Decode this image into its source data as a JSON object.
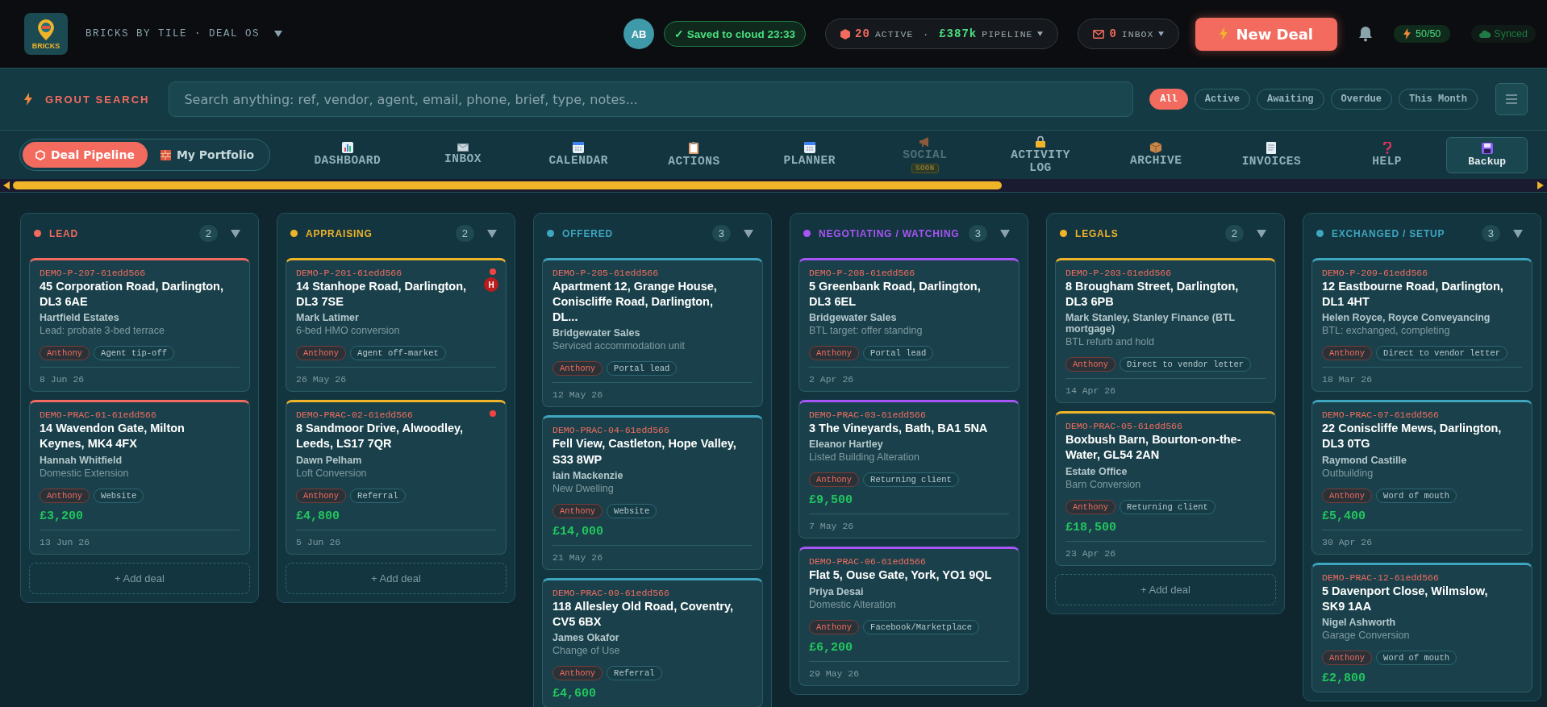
{
  "header": {
    "logo_text": "BRICKS",
    "app_title": "BRICKS BY TILE · DEAL OS",
    "avatar": "AB",
    "saved": "✓ Saved to cloud 23:33",
    "stats": {
      "active_count": "20",
      "active_label": "ACTIVE",
      "separator": "·",
      "pipeline_value": "£387k",
      "pipeline_label": "PIPELINE"
    },
    "inbox": {
      "count": "0",
      "label": "INBOX"
    },
    "new_deal": "New Deal",
    "quota": "50/50",
    "sync": "Synced"
  },
  "search": {
    "label": "GROUT SEARCH",
    "placeholder": "Search anything: ref, vendor, agent, email, phone, brief, type, notes...",
    "filters": [
      {
        "label": "All",
        "selected": true
      },
      {
        "label": "Active",
        "selected": false
      },
      {
        "label": "Awaiting",
        "selected": false
      },
      {
        "label": "Overdue",
        "selected": false
      },
      {
        "label": "This Month",
        "selected": false
      }
    ]
  },
  "modes": [
    {
      "label": "Deal Pipeline",
      "selected": true
    },
    {
      "label": "My Portfolio",
      "selected": false
    }
  ],
  "nav": [
    {
      "label": "DASHBOARD",
      "disabled": false
    },
    {
      "label": "INBOX",
      "disabled": false
    },
    {
      "label": "CALENDAR",
      "disabled": false
    },
    {
      "label": "ACTIONS",
      "disabled": false
    },
    {
      "label": "PLANNER",
      "disabled": false
    },
    {
      "label": "SOCIAL",
      "disabled": true,
      "badge": "SOON"
    },
    {
      "label": "ACTIVITY LOG",
      "disabled": false
    },
    {
      "label": "ARCHIVE",
      "disabled": false
    },
    {
      "label": "INVOICES",
      "disabled": false
    },
    {
      "label": "HELP",
      "disabled": false
    }
  ],
  "backup": {
    "label": "Backup"
  },
  "columns": [
    {
      "title": "LEAD",
      "color": "#f26b5e",
      "count": "2",
      "add_label": "+ Add deal",
      "cards": [
        {
          "ref": "DEMO-P-207-61edd566",
          "title": "45 Corporation Road, Darlington, DL3 6AE",
          "contact": "Hartfield Estates",
          "brief": "Lead: probate 3-bed terrace",
          "owner": "Anthony",
          "source": "Agent tip-off",
          "date": "8 Jun 26",
          "flagged": false
        },
        {
          "ref": "DEMO-PRAC-01-61edd566",
          "title": "14 Wavendon Gate, Milton Keynes, MK4 4FX",
          "contact": "Hannah Whitfield",
          "brief": "Domestic Extension",
          "owner": "Anthony",
          "source": "Website",
          "value": "£3,200",
          "date": "13 Jun 26",
          "flagged": false
        }
      ]
    },
    {
      "title": "APPRAISING",
      "color": "#f0b429",
      "count": "2",
      "add_label": "+ Add deal",
      "cards": [
        {
          "ref": "DEMO-P-201-61edd566",
          "title": "14 Stanhope Road, Darlington, DL3 7SE",
          "contact": "Mark Latimer",
          "brief": "6-bed HMO conversion",
          "owner": "Anthony",
          "source": "Agent off-market",
          "date": "26 May 26",
          "flagged": true,
          "badge": "H"
        },
        {
          "ref": "DEMO-PRAC-02-61edd566",
          "title": "8 Sandmoor Drive, Alwoodley, Leeds, LS17 7QR",
          "contact": "Dawn Pelham",
          "brief": "Loft Conversion",
          "owner": "Anthony",
          "source": "Referral",
          "value": "£4,800",
          "date": "5 Jun 26",
          "flagged": true
        }
      ]
    },
    {
      "title": "OFFERED",
      "color": "#3ea6bf",
      "count": "3",
      "cards": [
        {
          "ref": "DEMO-P-205-61edd566",
          "title": "Apartment 12, Grange House, Coniscliffe Road, Darlington, DL...",
          "contact": "Bridgewater Sales",
          "brief": "Serviced accommodation unit",
          "owner": "Anthony",
          "source": "Portal lead",
          "date": "12 May 26",
          "flagged": false
        },
        {
          "ref": "DEMO-PRAC-04-61edd566",
          "title": "Fell View, Castleton, Hope Valley, S33 8WP",
          "contact": "Iain Mackenzie",
          "brief": "New Dwelling",
          "owner": "Anthony",
          "source": "Website",
          "value": "£14,000",
          "date": "21 May 26",
          "flagged": false
        },
        {
          "ref": "DEMO-PRAC-09-61edd566",
          "title": "118 Allesley Old Road, Coventry, CV5 6BX",
          "contact": "James Okafor",
          "brief": "Change of Use",
          "owner": "Anthony",
          "source": "Referral",
          "value": "£4,600",
          "flagged": false
        }
      ]
    },
    {
      "title": "NEGOTIATING / WATCHING",
      "color": "#a855f7",
      "count": "3",
      "cards": [
        {
          "ref": "DEMO-P-208-61edd566",
          "title": "5 Greenbank Road, Darlington, DL3 6EL",
          "contact": "Bridgewater Sales",
          "brief": "BTL target: offer standing",
          "owner": "Anthony",
          "source": "Portal lead",
          "date": "2 Apr 26",
          "flagged": false
        },
        {
          "ref": "DEMO-PRAC-03-61edd566",
          "title": "3 The Vineyards, Bath, BA1 5NA",
          "contact": "Eleanor Hartley",
          "brief": "Listed Building Alteration",
          "owner": "Anthony",
          "source": "Returning client",
          "value": "£9,500",
          "date": "7 May 26",
          "flagged": false
        },
        {
          "ref": "DEMO-PRAC-06-61edd566",
          "title": "Flat 5, Ouse Gate, York, YO1 9QL",
          "contact": "Priya Desai",
          "brief": "Domestic Alteration",
          "owner": "Anthony",
          "source": "Facebook/Marketplace",
          "value": "£6,200",
          "date": "29 May 26",
          "flagged": false
        }
      ]
    },
    {
      "title": "LEGALS",
      "color": "#f0b429",
      "count": "2",
      "add_label": "+ Add deal",
      "cards": [
        {
          "ref": "DEMO-P-203-61edd566",
          "title": "8 Brougham Street, Darlington, DL3 6PB",
          "contact": "Mark Stanley, Stanley Finance (BTL mortgage)",
          "brief": "BTL refurb and hold",
          "owner": "Anthony",
          "source": "Direct to vendor letter",
          "date": "14 Apr 26",
          "flagged": false
        },
        {
          "ref": "DEMO-PRAC-05-61edd566",
          "title": "Boxbush Barn, Bourton-on-the-Water, GL54 2AN",
          "contact": "Estate Office",
          "brief": "Barn Conversion",
          "owner": "Anthony",
          "source": "Returning client",
          "value": "£18,500",
          "date": "23 Apr 26",
          "flagged": false
        }
      ]
    },
    {
      "title": "EXCHANGED / SETUP",
      "color": "#3ea6bf",
      "count": "3",
      "cards": [
        {
          "ref": "DEMO-P-209-61edd566",
          "title": "12 Eastbourne Road, Darlington, DL1 4HT",
          "contact": "Helen Royce, Royce Conveyancing",
          "brief": "BTL: exchanged, completing",
          "owner": "Anthony",
          "source": "Direct to vendor letter",
          "date": "18 Mar 26",
          "flagged": false
        },
        {
          "ref": "DEMO-PRAC-07-61edd566",
          "title": "22 Coniscliffe Mews, Darlington, DL3 0TG",
          "contact": "Raymond Castille",
          "brief": "Outbuilding",
          "owner": "Anthony",
          "source": "Word of mouth",
          "value": "£5,400",
          "date": "30 Apr 26",
          "flagged": false
        },
        {
          "ref": "DEMO-PRAC-12-61edd566",
          "title": "5 Davenport Close, Wilmslow, SK9 1AA",
          "contact": "Nigel Ashworth",
          "brief": "Garage Conversion",
          "owner": "Anthony",
          "source": "Word of mouth",
          "value": "£2,800",
          "flagged": false
        }
      ]
    }
  ]
}
